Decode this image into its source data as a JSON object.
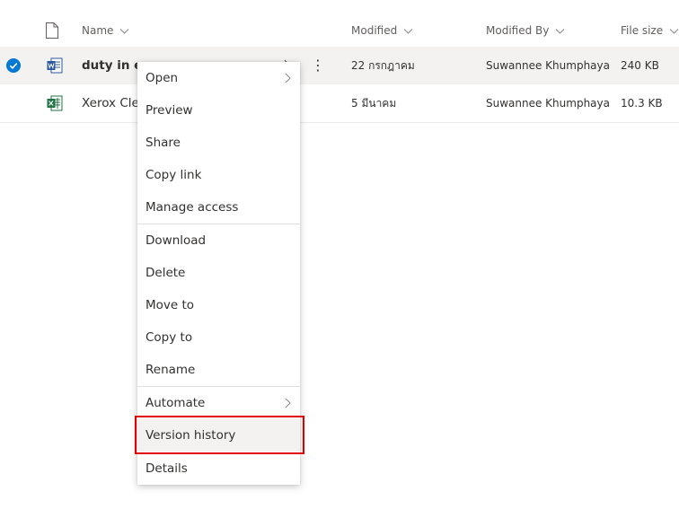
{
  "columns": {
    "name": "Name",
    "modified": "Modified",
    "modified_by": "Modified By",
    "file_size": "File size"
  },
  "files": [
    {
      "name": "duty in ea",
      "icon": "word-file-icon",
      "modified": "22 กรกฎาคม",
      "modified_by": "Suwannee Khumphaya",
      "file_size": "240 KB",
      "selected": true
    },
    {
      "name": "Xerox Clea",
      "icon": "excel-file-icon",
      "modified": "5 มีนาคม",
      "modified_by": "Suwannee Khumphaya",
      "file_size": "10.3 KB",
      "selected": false
    }
  ],
  "context_menu": {
    "items": [
      {
        "label": "Open",
        "submenu": true
      },
      {
        "label": "Preview"
      },
      {
        "label": "Share"
      },
      {
        "label": "Copy link"
      },
      {
        "label": "Manage access"
      },
      {
        "label": "Download"
      },
      {
        "label": "Delete"
      },
      {
        "label": "Move to"
      },
      {
        "label": "Copy to"
      },
      {
        "label": "Rename"
      },
      {
        "label": "Automate",
        "submenu": true
      },
      {
        "label": "Version history",
        "highlighted": true
      },
      {
        "label": "Details"
      }
    ]
  },
  "colors": {
    "selection_check": "#0078d4",
    "word_blue": "#2b579a",
    "excel_green": "#217346",
    "highlight_box": "#e00000"
  }
}
